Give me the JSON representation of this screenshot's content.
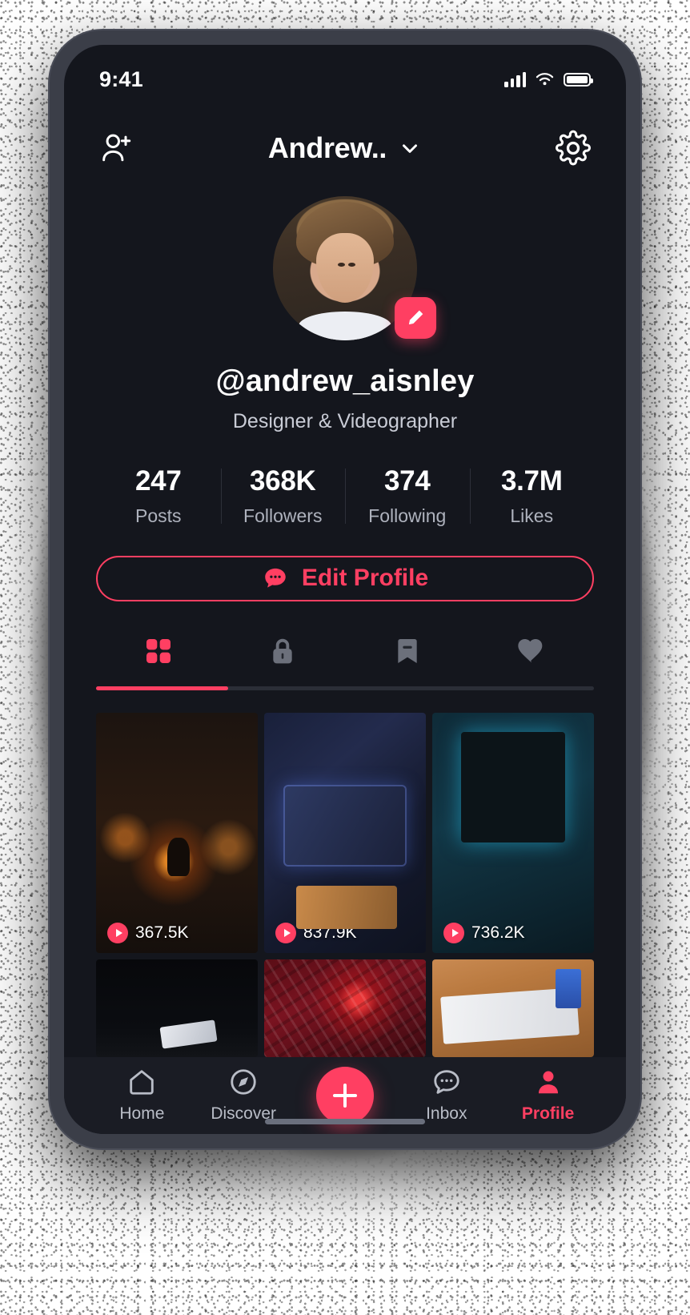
{
  "theme": {
    "accent": "#ff3f62",
    "screen_bg": "#14161d",
    "nav_bg": "#1a1c24",
    "text_primary": "#ffffff",
    "text_secondary": "#aeb2bd"
  },
  "status_bar": {
    "time": "9:41",
    "signal_icon": "cellular-bars-icon",
    "wifi_icon": "wifi-icon",
    "battery_icon": "battery-full-icon"
  },
  "header": {
    "add_friend_icon": "add-person-icon",
    "title": "Andrew..",
    "chevron_icon": "chevron-down-icon",
    "settings_icon": "gear-icon"
  },
  "profile": {
    "avatar_alt": "profile-photo",
    "edit_avatar_icon": "pencil-icon",
    "username": "@andrew_aisnley",
    "bio": "Designer & Videographer"
  },
  "stats": [
    {
      "value": "247",
      "label": "Posts"
    },
    {
      "value": "368K",
      "label": "Followers"
    },
    {
      "value": "374",
      "label": "Following"
    },
    {
      "value": "3.7M",
      "label": "Likes"
    }
  ],
  "edit_profile": {
    "label": "Edit Profile",
    "icon": "chat-dots-icon"
  },
  "tabs": [
    {
      "icon": "grid-icon",
      "name": "tab-grid",
      "active": true
    },
    {
      "icon": "lock-icon",
      "name": "tab-private",
      "active": false
    },
    {
      "icon": "bookmark-icon",
      "name": "tab-saved",
      "active": false
    },
    {
      "icon": "heart-icon",
      "name": "tab-liked",
      "active": false
    }
  ],
  "grid": [
    {
      "art": "t1",
      "views": "367.5K",
      "play_icon": "play-icon"
    },
    {
      "art": "t2",
      "views": "837.9K",
      "play_icon": "play-icon"
    },
    {
      "art": "t3",
      "views": "736.2K",
      "play_icon": "play-icon"
    },
    {
      "art": "t4",
      "views": "",
      "play_icon": "play-icon"
    },
    {
      "art": "t5",
      "views": "",
      "play_icon": "play-icon"
    },
    {
      "art": "t6",
      "views": "",
      "play_icon": "play-icon"
    }
  ],
  "bottom_nav": [
    {
      "label": "Home",
      "icon": "home-icon",
      "active": false
    },
    {
      "label": "Discover",
      "icon": "compass-icon",
      "active": false
    },
    {
      "label": "Inbox",
      "icon": "message-icon",
      "active": false
    },
    {
      "label": "Profile",
      "icon": "person-icon",
      "active": true
    }
  ],
  "create_button": {
    "icon": "plus-icon"
  }
}
